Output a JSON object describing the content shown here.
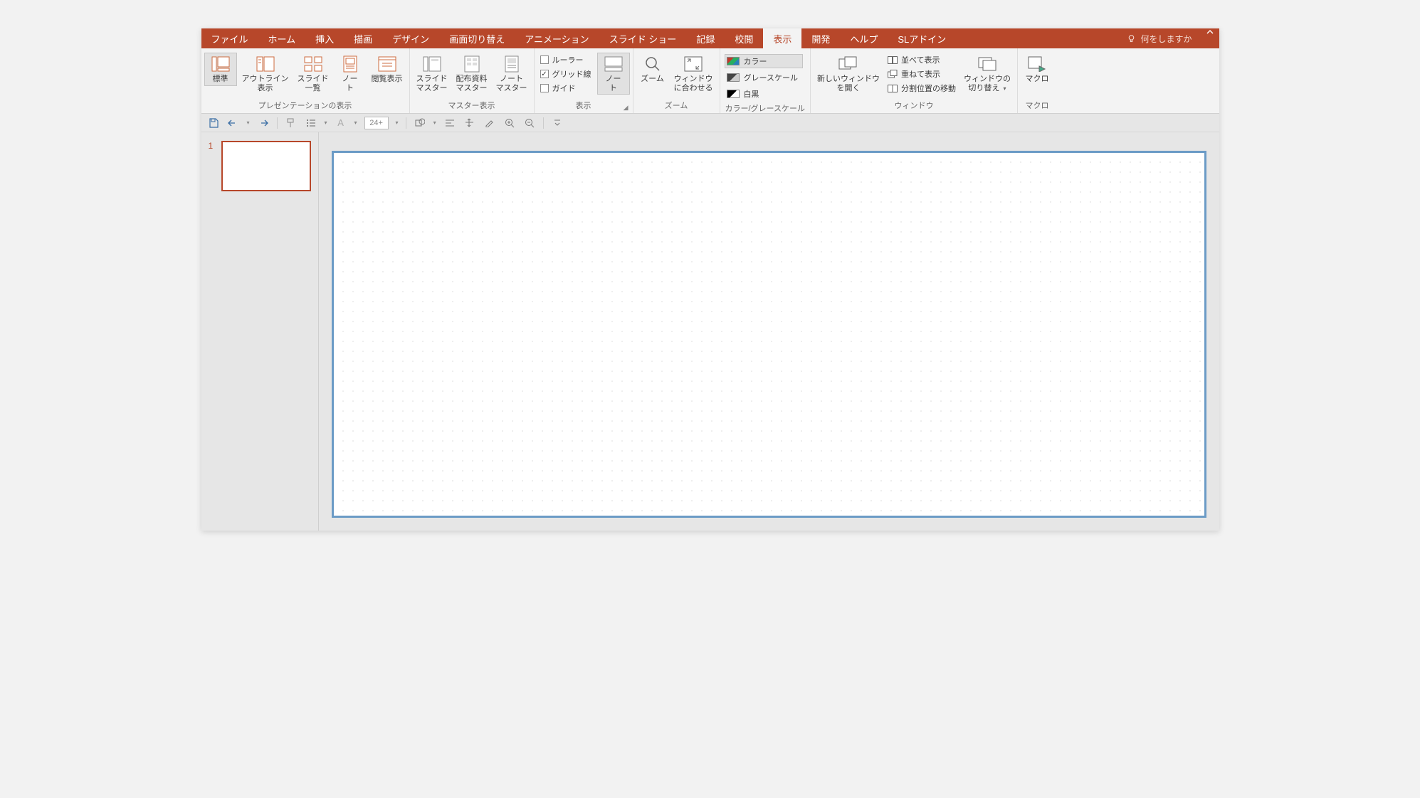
{
  "ribbon": {
    "tabs": [
      {
        "label": "ファイル"
      },
      {
        "label": "ホーム"
      },
      {
        "label": "挿入"
      },
      {
        "label": "描画"
      },
      {
        "label": "デザイン"
      },
      {
        "label": "画面切り替え"
      },
      {
        "label": "アニメーション"
      },
      {
        "label": "スライド ショー"
      },
      {
        "label": "記録"
      },
      {
        "label": "校閲"
      },
      {
        "label": "表示"
      },
      {
        "label": "開発"
      },
      {
        "label": "ヘルプ"
      },
      {
        "label": "SLアドイン"
      }
    ],
    "active_tab_index": 10,
    "tellme_placeholder": "何をしますか"
  },
  "groups": {
    "presentation_views": {
      "label": "プレゼンテーションの表示",
      "buttons": {
        "normal": "標準",
        "outline": "アウトライン\n表示",
        "slide_sorter": "スライド\n一覧",
        "notes_page": "ノー\nト",
        "reading_view": "閲覧表示"
      }
    },
    "master_views": {
      "label": "マスター表示",
      "buttons": {
        "slide_master": "スライド\nマスター",
        "handout_master": "配布資料\nマスター",
        "notes_master": "ノート\nマスター"
      }
    },
    "show": {
      "label": "表示",
      "ruler": "ルーラー",
      "gridlines": "グリッド線",
      "guides": "ガイド",
      "notes_btn": "ノー\nト",
      "ruler_checked": false,
      "gridlines_checked": true,
      "guides_checked": false
    },
    "zoom": {
      "label": "ズーム",
      "zoom_btn": "ズーム",
      "fit_btn": "ウィンドウ\nに合わせる"
    },
    "color_gray": {
      "label": "カラー/グレースケール",
      "color": "カラー",
      "grayscale": "グレースケール",
      "bw": "白黒",
      "active": "color"
    },
    "window": {
      "label": "ウィンドウ",
      "new_window": "新しいウィンドウ\nを開く",
      "arrange_all": "並べて表示",
      "cascade": "重ねて表示",
      "move_split": "分割位置の移動",
      "switch": "ウィンドウの\n切り替え"
    },
    "macros": {
      "label": "マクロ",
      "btn": "マクロ"
    }
  },
  "qat": {
    "font_size": "24+"
  },
  "thumbs": {
    "items": [
      {
        "number": "1"
      }
    ]
  }
}
